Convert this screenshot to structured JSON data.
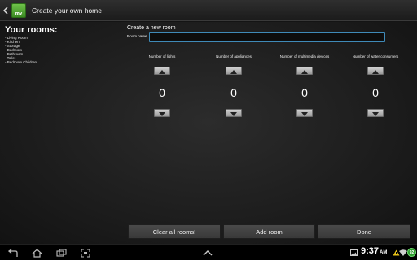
{
  "actionbar": {
    "app_icon_text": "my",
    "title": "Create your own home"
  },
  "rooms": {
    "heading": "Your rooms:",
    "items": [
      "- Living Room",
      "- Kitchen",
      "- Storage",
      "- Bedroom",
      "- Bathroom",
      "- Toilet",
      "- Bedroom Children"
    ]
  },
  "create": {
    "heading": "Create a new room",
    "name_label": "Room name",
    "name_value": "",
    "name_placeholder": ""
  },
  "counters": [
    {
      "label": "Number of lights",
      "value": "0"
    },
    {
      "label": "Number of appliances",
      "value": "0"
    },
    {
      "label": "Number of multimedia devices",
      "value": "0"
    },
    {
      "label": "Number of water consumers",
      "value": "0"
    }
  ],
  "buttons": {
    "clear": "Clear all rooms!",
    "add": "Add room",
    "done": "Done"
  },
  "statusbar": {
    "time": "9:37",
    "ampm": "AM",
    "battery": "92"
  },
  "colors": {
    "accent": "#3f8ab8",
    "battery": "#2f9e2f"
  }
}
